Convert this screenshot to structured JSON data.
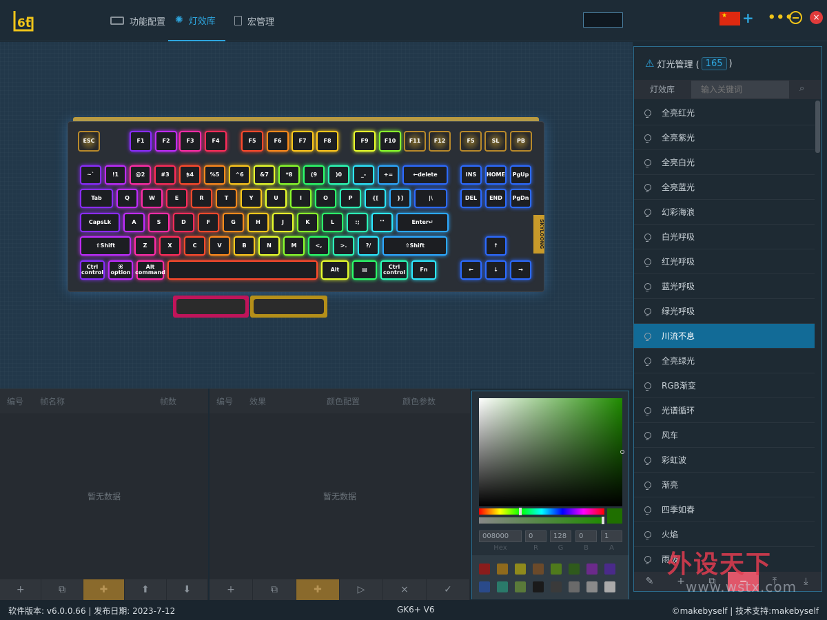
{
  "app": {
    "logo_text": "6t"
  },
  "nav": {
    "tabs": [
      {
        "label": "功能配置",
        "icon": "keyboard-icon"
      },
      {
        "label": "灯效库",
        "icon": "bulb-icon",
        "active": true
      },
      {
        "label": "宏管理",
        "icon": "document-icon"
      }
    ]
  },
  "top_right": {
    "plus": "+",
    "more": "•••",
    "close": "×"
  },
  "keyboard": {
    "side_label": "SKYLOONG",
    "fn_row": [
      "ESC",
      "F1",
      "F2",
      "F3",
      "F4",
      "F5",
      "F6",
      "F7",
      "F8",
      "F9",
      "F10",
      "F11",
      "F12",
      "F5",
      "SL",
      "PB"
    ],
    "num_row": [
      "~`",
      "!1",
      "@2",
      "#3",
      "$4",
      "%5",
      "^6",
      "&7",
      "*8",
      "(9",
      ")0",
      "_-",
      "+=",
      "←delete"
    ],
    "nav1": [
      "INS",
      "HOME",
      "PgUp"
    ],
    "q_row": [
      "Tab",
      "Q",
      "W",
      "E",
      "R",
      "T",
      "Y",
      "U",
      "I",
      "O",
      "P",
      "{[",
      "}]",
      "|\\"
    ],
    "nav2": [
      "DEL",
      "END",
      "PgDn"
    ],
    "a_row": [
      "CapsLk",
      "A",
      "S",
      "D",
      "F",
      "G",
      "H",
      "J",
      "K",
      "L",
      ":;",
      "\"'",
      "Enter↵"
    ],
    "z_row": [
      "⇧Shift",
      "Z",
      "X",
      "C",
      "V",
      "B",
      "N",
      "M",
      "<,",
      ">.",
      "?/",
      "⇧Shift"
    ],
    "arrows": [
      "↑",
      "←",
      "↓",
      "→"
    ],
    "bottom_row": [
      "Ctrl control",
      "⌘ option",
      "Alt command",
      "",
      "Alt",
      "▤",
      "Ctrl control",
      "Fn"
    ]
  },
  "frames_panel": {
    "headers": [
      "编号",
      "帧名称",
      "帧数"
    ],
    "empty": "暂无数据",
    "footer": [
      "+",
      "⧉",
      "✚",
      "⬆",
      "⬇"
    ]
  },
  "effects_panel": {
    "headers": [
      "编号",
      "效果",
      "颜色配置",
      "颜色参数"
    ],
    "empty": "暂无数据",
    "footer": [
      "+",
      "⧉",
      "✚",
      "▷",
      "×",
      "✓"
    ]
  },
  "color_picker": {
    "hex": "008000",
    "r": "0",
    "g": "128",
    "b": "0",
    "a": "1",
    "labels": [
      "Hex",
      "R",
      "G",
      "B",
      "A"
    ],
    "swatches": [
      "#8a1c1c",
      "#8f6a1c",
      "#8f8a1c",
      "#6b4a2a",
      "#4f7a1c",
      "#2f5a1c",
      "#6b2a8a",
      "#4a2a8a",
      "#2a4a8a",
      "#2a7a6a",
      "#5a7a3a",
      "#1a1a1a",
      "#3a3a3a",
      "#6a6a6a",
      "#8a8a8a",
      "#aaaaaa"
    ]
  },
  "light_manager": {
    "title": "灯光管理 (",
    "count": "165",
    "title_end": ")",
    "tab": "灯效库",
    "search_placeholder": "输入关键词",
    "items": [
      "全亮红光",
      "全亮紫光",
      "全亮白光",
      "全亮蓝光",
      "幻彩海浪",
      "白光呼吸",
      "红光呼吸",
      "蓝光呼吸",
      "绿光呼吸",
      "川流不息",
      "全亮绿光",
      "RGB渐变",
      "光谱循环",
      "风车",
      "彩虹波",
      "渐亮",
      "四季如春",
      "火焰",
      "雨极"
    ],
    "selected_index": 9,
    "footer": [
      "✎",
      "+",
      "⧉",
      "−",
      "⤒",
      "⤓"
    ]
  },
  "watermark": {
    "cn": "外设天下",
    "url": "www.wstx.com"
  },
  "status": {
    "version": "软件版本: v6.0.0.66 | 发布日期: 2023-7-12",
    "model": "GK6+ V6",
    "support": "©makebyself | 技术支持:makebyself"
  },
  "colors": {
    "accent": "#2ea7e0",
    "gold": "#f0c419",
    "selected": "#126b97",
    "danger": "#e03b3b"
  }
}
